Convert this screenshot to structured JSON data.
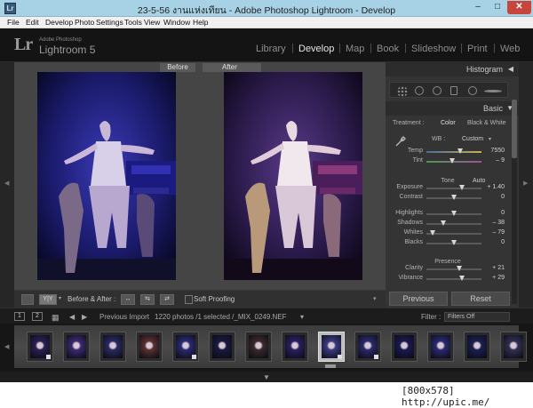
{
  "window": {
    "title": "23-5-56 งานแห่งเทียน - Adobe Photoshop Lightroom - Develop",
    "app_icon": "Lr",
    "controls": {
      "minimize": "–",
      "maximize": "□",
      "close": "✕"
    }
  },
  "menubar": [
    "File",
    "Edit",
    "Develop",
    "Photo",
    "Settings",
    "Tools",
    "View",
    "Window",
    "Help"
  ],
  "identity_plate": {
    "logo": "Lr",
    "company": "Adobe Photoshop",
    "product": "Lightroom 5"
  },
  "modules": [
    {
      "label": "Library",
      "active": false
    },
    {
      "label": "Develop",
      "active": true
    },
    {
      "label": "Map",
      "active": false
    },
    {
      "label": "Book",
      "active": false
    },
    {
      "label": "Slideshow",
      "active": false
    },
    {
      "label": "Print",
      "active": false
    },
    {
      "label": "Web",
      "active": false
    }
  ],
  "module_separator": "|",
  "compare_view": {
    "before_label": "Before",
    "after_label": "After"
  },
  "toolbar": {
    "view_mode": "Y|Y",
    "before_after_label": "Before & After :",
    "soft_proofing_label": "Soft Proofing",
    "soft_proofing_checked": false
  },
  "right_panel": {
    "histogram_title": "Histogram",
    "basic_title": "Basic",
    "treatment_label": "Treatment :",
    "treatment_color": "Color",
    "treatment_bw": "Black & White",
    "wb_label": "WB :",
    "wb_value": "Custom",
    "sliders_wb": [
      {
        "label": "Temp",
        "value": "7550",
        "position": 0.62
      },
      {
        "label": "Tint",
        "value": "– 9",
        "position": 0.46
      }
    ],
    "tone_label": "Tone",
    "auto_label": "Auto",
    "sliders_tone": [
      {
        "label": "Exposure",
        "value": "+ 1.40",
        "position": 0.64
      },
      {
        "label": "Contrast",
        "value": "0",
        "position": 0.5
      },
      {
        "label": "Highlights",
        "value": "0",
        "position": 0.5
      },
      {
        "label": "Shadows",
        "value": "– 38",
        "position": 0.31
      },
      {
        "label": "Whites",
        "value": "– 79",
        "position": 0.11
      },
      {
        "label": "Blacks",
        "value": "0",
        "position": 0.5
      }
    ],
    "presence_label": "Presence",
    "sliders_presence": [
      {
        "label": "Clarity",
        "value": "+ 21",
        "position": 0.6
      },
      {
        "label": "Vibrance",
        "value": "+ 29",
        "position": 0.64
      }
    ],
    "previous_button": "Previous",
    "reset_button": "Reset"
  },
  "filmstrip": {
    "page1": "1",
    "page2": "2",
    "source_label": "Previous Import",
    "count_text": "1220 photos /1 selected /_MIX_0249.NEF",
    "dropdown_glyph": "▾",
    "filter_label": "Filter :",
    "filter_value": "Filters Off",
    "selected_index": 8,
    "thumbnail_count": 14
  },
  "watermark": "[800x578] http://upic.me/",
  "colors": {
    "titlebar": "#a7d1e4",
    "close_button": "#c7453b",
    "panel_bg": "#343434",
    "active_module": "#e6e6e6"
  }
}
